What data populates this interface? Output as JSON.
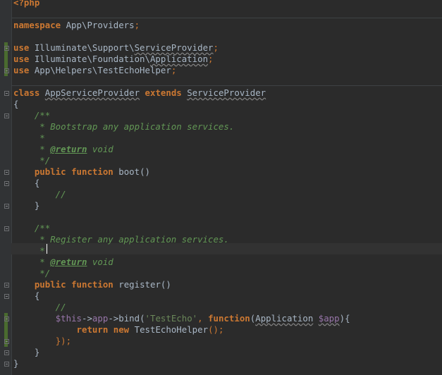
{
  "editor": {
    "colors": {
      "background": "#2b2b2b",
      "keyword": "#cc7832",
      "comment": "#629755",
      "string": "#6a8759",
      "function": "#ffc66d",
      "variable": "#9876aa",
      "text": "#a9b7c6"
    },
    "lines": {
      "l1": "<?php",
      "l3a": "namespace",
      "l3b": " App\\Providers",
      "l3c": ";",
      "l5a": "use",
      "l5b": " Illuminate\\Support\\",
      "l5c": "ServiceProvider",
      "l5d": ";",
      "l6a": "use",
      "l6b": " Illuminate\\Foundation\\",
      "l6c": "Application",
      "l6d": ";",
      "l7a": "use",
      "l7b": " App\\Helpers\\TestEchoHelper",
      "l7c": ";",
      "l9a": "class",
      "l9b": "AppServiceProvider",
      "l9c": "extends",
      "l9d": "ServiceProvider",
      "l10": "{",
      "l11": "    /**",
      "l12": "     * Bootstrap any application services.",
      "l13": "     *",
      "l14a": "     * ",
      "l14b": "@return",
      "l14c": " void",
      "l15": "     */",
      "l16a": "    public",
      "l16b": "function",
      "l16c": "boot",
      "l16d": "()",
      "l17": "    {",
      "l18": "        //",
      "l19": "    }",
      "l21": "    /**",
      "l22": "     * Register any application services.",
      "l23": "     *",
      "l24a": "     * ",
      "l24b": "@return",
      "l24c": " void",
      "l25": "     */",
      "l26a": "    public",
      "l26b": "function",
      "l26c": "register",
      "l26d": "()",
      "l27": "    {",
      "l28": "        //",
      "l29a": "        ",
      "l29b": "$this",
      "l29c": "->",
      "l29d": "app",
      "l29e": "->",
      "l29f": "bind",
      "l29g": "(",
      "l29h": "'TestEcho'",
      "l29i": ", ",
      "l29j": "function",
      "l29k": "(",
      "l29l": "Application",
      "l29m": " ",
      "l29n": "$app",
      "l29o": "){",
      "l30a": "            ",
      "l30b": "return",
      "l30c": "new",
      "l30d": "TestEchoHelper",
      "l30e": "();",
      "l31a": "        ",
      "l31b": "});",
      "l32": "    }",
      "l33": "}"
    }
  }
}
